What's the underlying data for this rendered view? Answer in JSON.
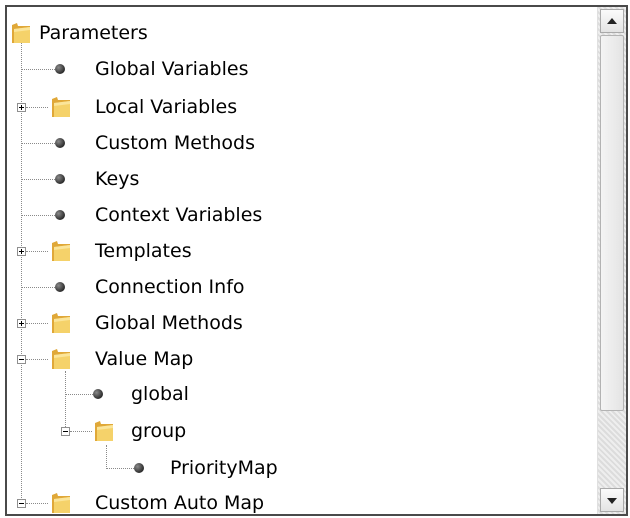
{
  "tree": {
    "items": [
      {
        "label": "Parameters",
        "icon": "folder-icon"
      },
      {
        "label": "Global Variables",
        "icon": "bullet-icon"
      },
      {
        "label": "Local Variables",
        "icon": "folder-icon",
        "expander": "collapsed"
      },
      {
        "label": "Custom Methods",
        "icon": "bullet-icon"
      },
      {
        "label": "Keys",
        "icon": "bullet-icon"
      },
      {
        "label": "Context Variables",
        "icon": "bullet-icon"
      },
      {
        "label": "Templates",
        "icon": "folder-icon",
        "expander": "collapsed"
      },
      {
        "label": "Connection Info",
        "icon": "bullet-icon"
      },
      {
        "label": "Global Methods",
        "icon": "folder-icon",
        "expander": "collapsed"
      },
      {
        "label": "Value Map",
        "icon": "folder-icon",
        "expander": "expanded"
      },
      {
        "label": "global",
        "icon": "bullet-icon"
      },
      {
        "label": "group",
        "icon": "folder-icon",
        "expander": "expanded"
      },
      {
        "label": "PriorityMap",
        "icon": "bullet-icon"
      },
      {
        "label": "Custom Auto Map",
        "icon": "folder-icon",
        "expander": "expanded"
      }
    ]
  },
  "scrollbar": {
    "up_icon": "arrow-up-icon",
    "down_icon": "arrow-down-icon"
  },
  "colors": {
    "folder": "#f2c94c",
    "connector": "#8a8a8a",
    "bullet": "#2b2b2b"
  }
}
